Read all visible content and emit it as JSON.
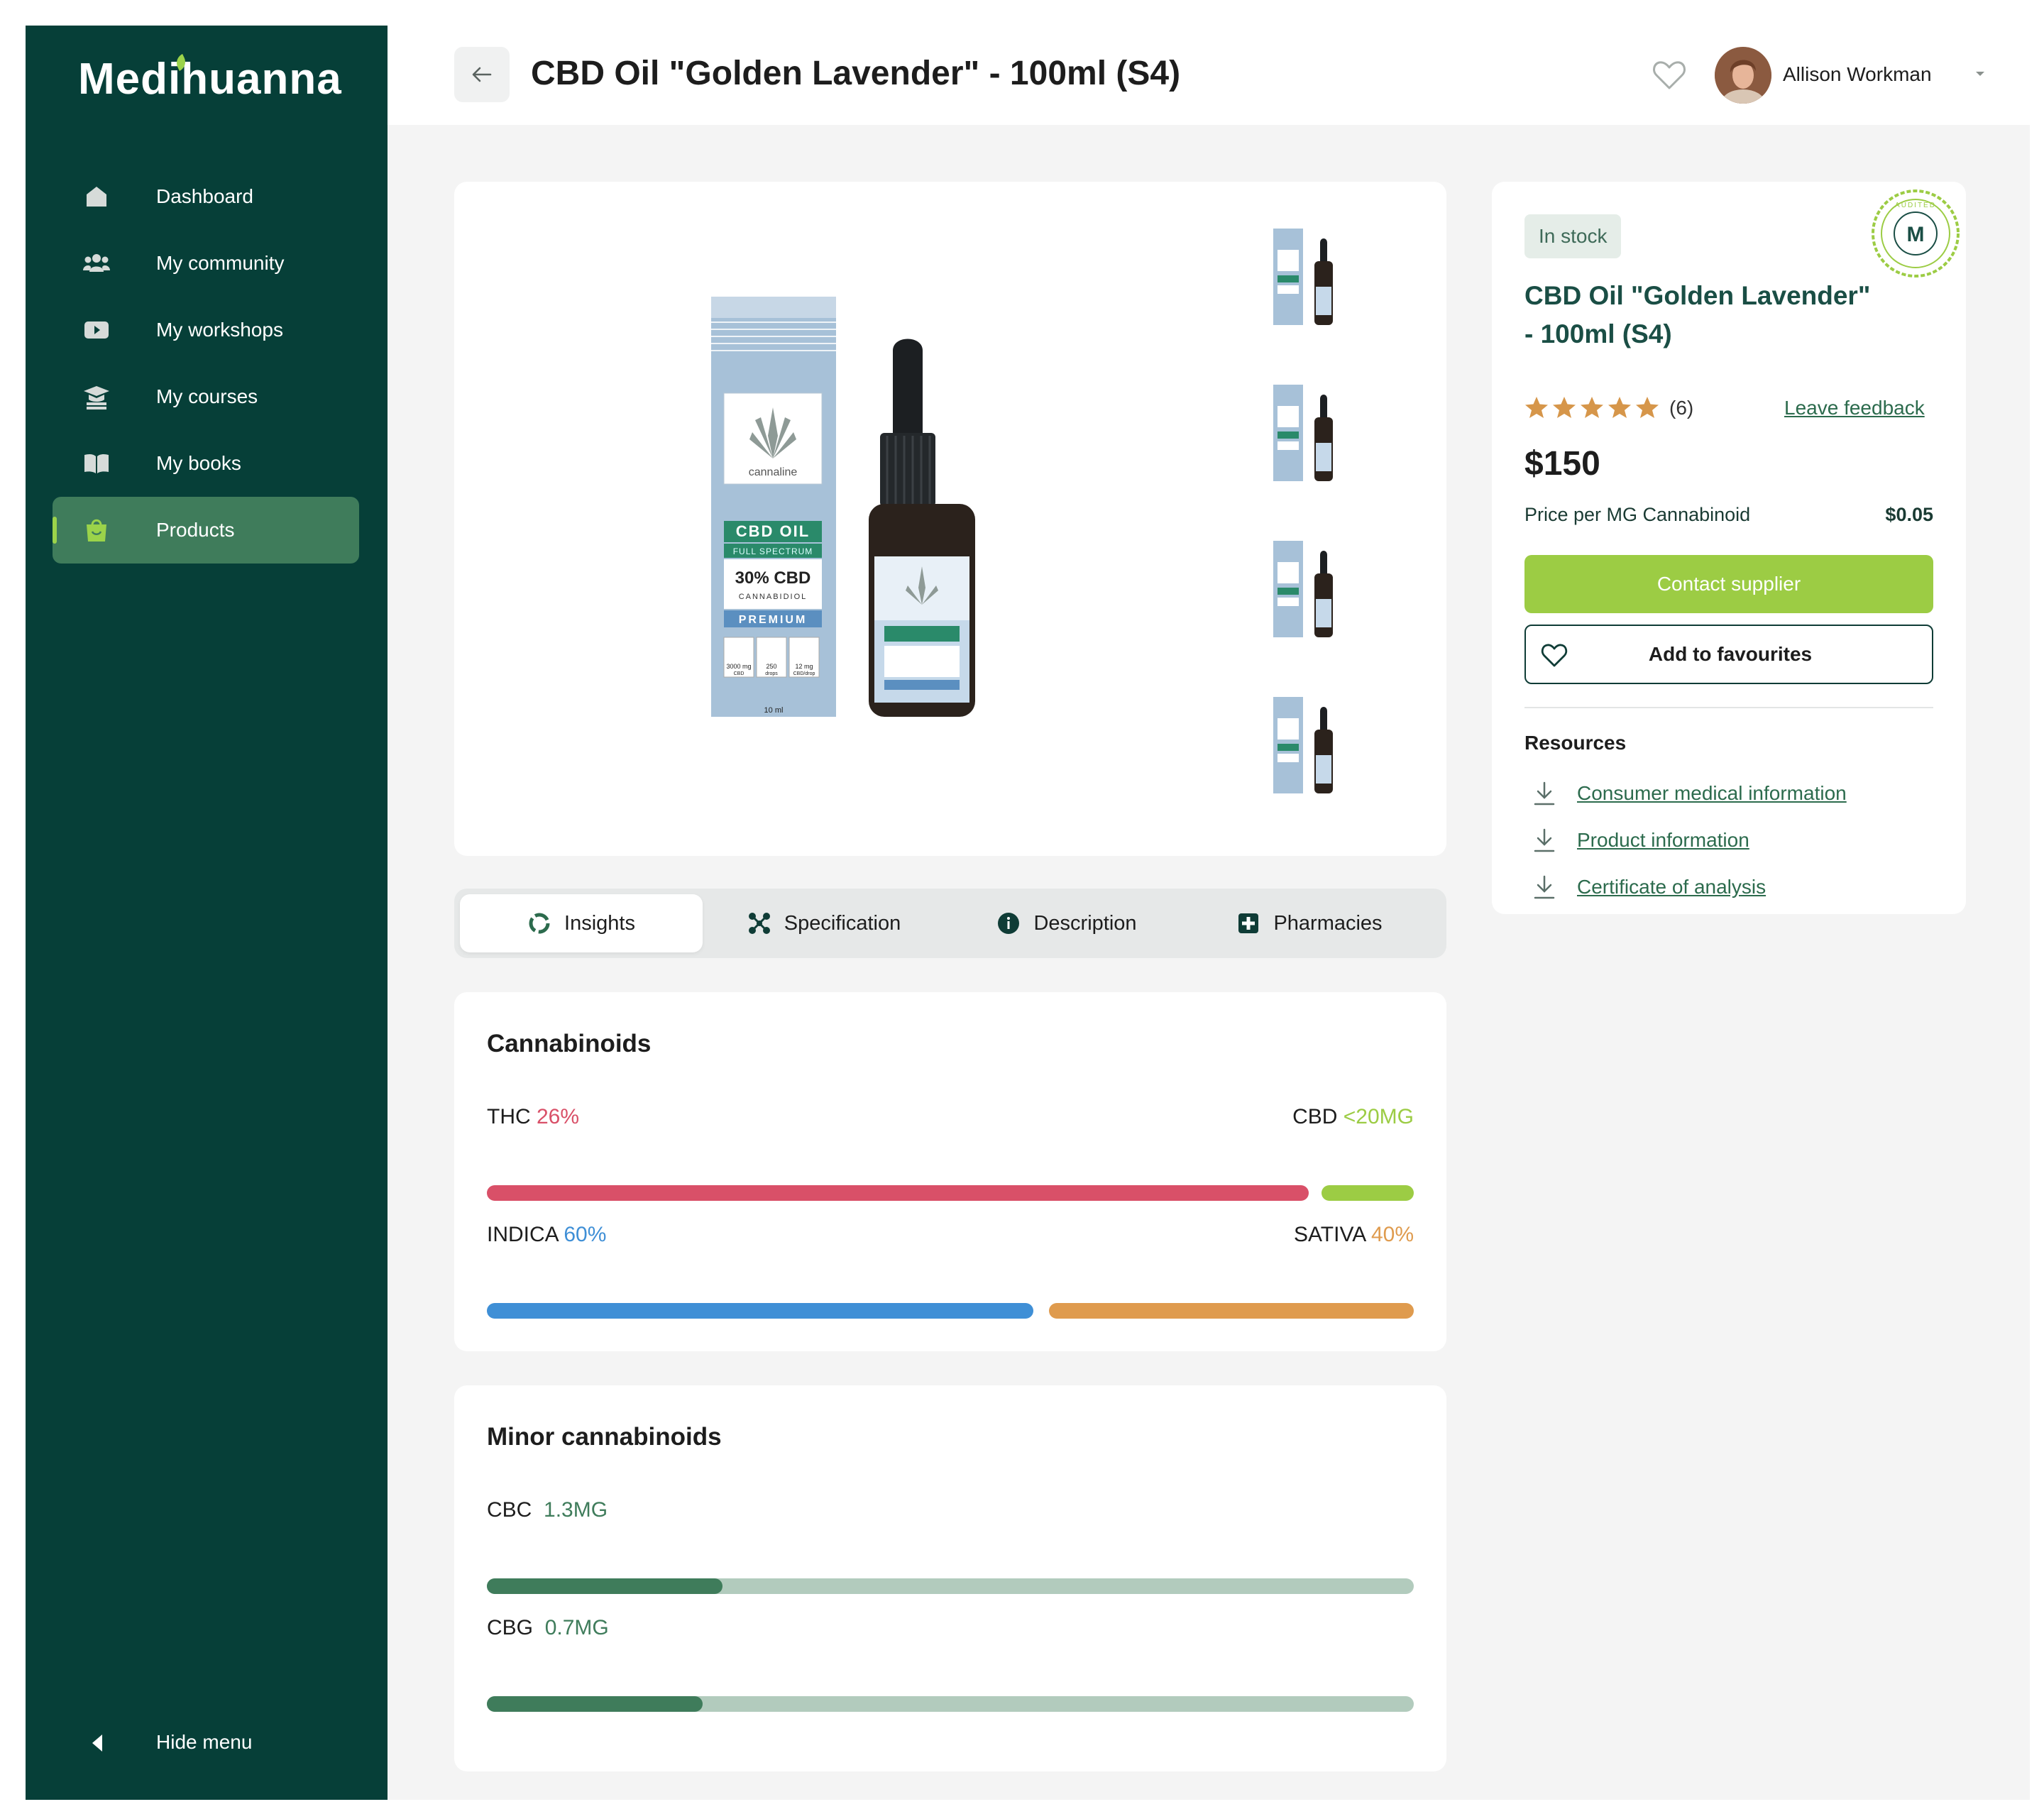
{
  "app": {
    "brand": "Medihuanna"
  },
  "sidebar": {
    "items": [
      {
        "label": "Dashboard",
        "icon": "home-icon"
      },
      {
        "label": "My community",
        "icon": "community-icon"
      },
      {
        "label": "My workshops",
        "icon": "video-icon"
      },
      {
        "label": "My courses",
        "icon": "graduation-cap-icon"
      },
      {
        "label": "My books",
        "icon": "book-icon"
      },
      {
        "label": "Products",
        "icon": "shopping-bag-icon",
        "active": true
      }
    ],
    "hide_menu_label": "Hide menu"
  },
  "header": {
    "title": "CBD Oil \"Golden Lavender\" - 100ml (S4)",
    "user_name": "Allison Workman"
  },
  "gallery": {
    "product_box": {
      "brand": "cannaline",
      "line1": "CBD OIL",
      "line2": "FULL SPECTRUM",
      "line3": "30% CBD",
      "line4": "CANNABIDIOL",
      "line5": "PREMIUM",
      "volume": "10 ml",
      "feature_1": "3000 mg",
      "feature_1_sub": "CBD",
      "feature_2": "250",
      "feature_2_sub": "drops",
      "feature_3": "12 mg",
      "feature_3_sub": "CBD/drop"
    },
    "thumbnail_count": 4
  },
  "tabs": [
    {
      "label": "Insights",
      "icon": "insights-icon",
      "active": true
    },
    {
      "label": "Specification",
      "icon": "specification-icon"
    },
    {
      "label": "Description",
      "icon": "info-icon"
    },
    {
      "label": "Pharmacies",
      "icon": "pharmacy-cross-icon"
    }
  ],
  "cannabinoids": {
    "title": "Cannabinoids",
    "thc": {
      "label": "THC",
      "value": "26%"
    },
    "cbd": {
      "label": "CBD",
      "value": "<20MG"
    },
    "indica": {
      "label": "INDICA",
      "value": "60%",
      "fraction": 0.6
    },
    "sativa": {
      "label": "SATIVA",
      "value": "40%",
      "fraction": 0.4
    }
  },
  "minor": {
    "title": "Minor cannabinoids",
    "cbc": {
      "label": "CBC",
      "value": "1.3MG"
    },
    "cbg": {
      "label": "CBG",
      "value": "0.7MG"
    }
  },
  "product": {
    "stock": "In stock",
    "badge": {
      "letter": "M",
      "ring_text": "AUDITED"
    },
    "title": "CBD Oil \"Golden Lavender\" - 100ml (S4)",
    "rating": 5,
    "reviews": "(6)",
    "feedback": "Leave feedback",
    "price": "$150",
    "ppm_label": "Price per MG Cannabinoid",
    "ppm_value": "$0.05",
    "contact": "Contact supplier",
    "favourite": "Add to favourites",
    "resources_title": "Resources",
    "resources": [
      "Consumer medical information",
      "Product information",
      "Certificate of analysis"
    ]
  },
  "colors": {
    "sidebar": "#063f38",
    "active_nav": "#3f7c5b",
    "accent_green": "#9ccc44",
    "thc": "#d95068",
    "cbd": "#9ccc44",
    "indica": "#3f8fd6",
    "sativa": "#df9b4e",
    "minor_fill": "#3f7c5b",
    "minor_track": "#b2cbbd",
    "star": "#d6964a"
  }
}
